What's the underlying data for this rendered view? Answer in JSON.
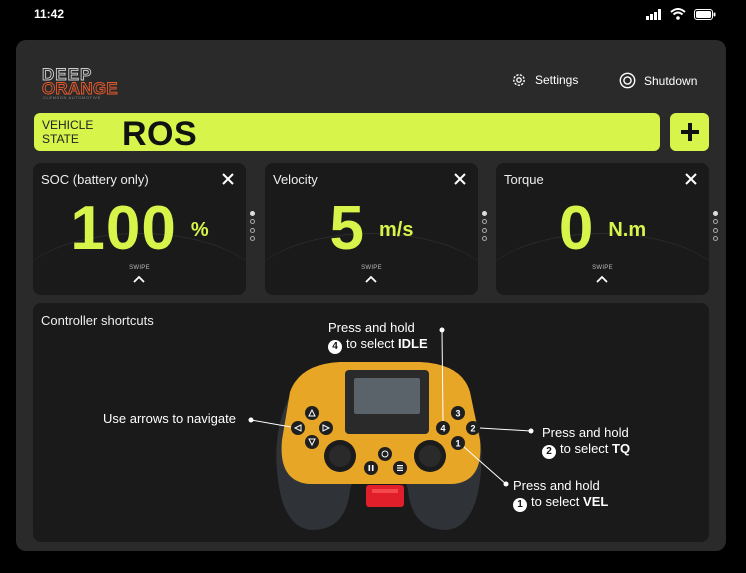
{
  "status_bar": {
    "time": "11:42"
  },
  "header": {
    "logo_line1": "DEEP",
    "logo_line2": "ORANGE",
    "logo_tagline": "CLEMSON AUTOMOTIVE",
    "settings_label": "Settings",
    "shutdown_label": "Shutdown"
  },
  "vehicle_state": {
    "label_line1": "VEHICLE",
    "label_line2": "STATE",
    "value": "ROS"
  },
  "cards": [
    {
      "title": "SOC (battery only)",
      "value": "100",
      "unit": "%",
      "swipe": "SWIPE"
    },
    {
      "title": "Velocity",
      "value": "5",
      "unit": "m/s",
      "swipe": "SWIPE"
    },
    {
      "title": "Torque",
      "value": "0",
      "unit": "N.m",
      "swipe": "SWIPE"
    }
  ],
  "controller": {
    "title": "Controller shortcuts",
    "arrows_note": "Use arrows to navigate",
    "idle": {
      "line1": "Press and hold",
      "badge": "4",
      "prefix": "to select",
      "target": "IDLE"
    },
    "tq": {
      "line1": "Press and hold",
      "badge": "2",
      "prefix": "to select",
      "target": "TQ"
    },
    "vel": {
      "line1": "Press and hold",
      "badge": "1",
      "prefix": "to select",
      "target": "VEL"
    },
    "button_labels": [
      "1",
      "2",
      "3",
      "4"
    ]
  },
  "colors": {
    "accent": "#d6f44a",
    "panel": "#2a2a2a",
    "card": "#1a1a1a",
    "controller_body": "#e8a627",
    "controller_grip": "#2f3337",
    "trigger": "#e01f2a"
  }
}
